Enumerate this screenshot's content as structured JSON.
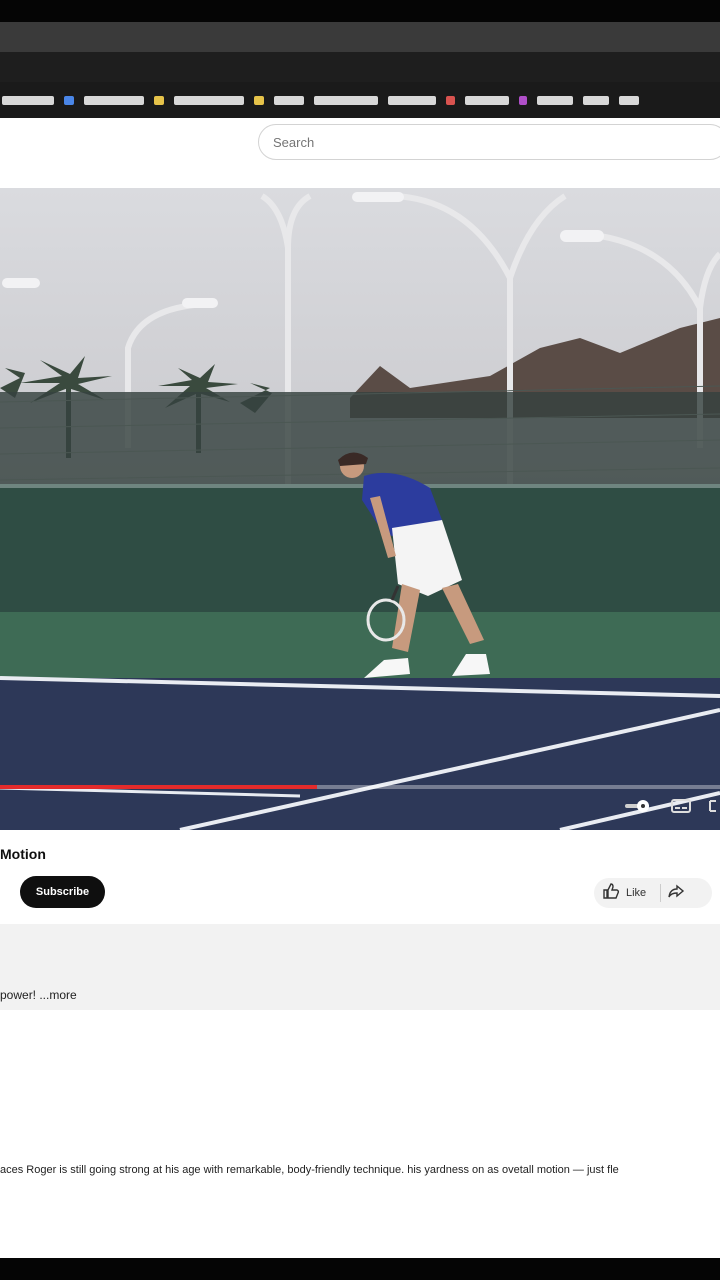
{
  "search": {
    "placeholder": "Search"
  },
  "video": {
    "title": "Motion",
    "progress_fraction": 0.44
  },
  "channel": {
    "subscribe_label": "Subscribe"
  },
  "actions": {
    "like_label": "Like"
  },
  "description": {
    "snippet": "power! ...more",
    "text": "aces Roger is still going strong at his age with remarkable, body-friendly technique. his yardness on as ovetall motion — just fle"
  },
  "colors": {
    "progress": "#e32b2b",
    "court_blue": "#2d3858",
    "court_green": "#3e6b55",
    "wall": "#2f4d44",
    "subscribe_bg": "#0f0f0f"
  },
  "icons": [
    "like-icon",
    "share-icon",
    "settings-icon",
    "captions-icon",
    "fullscreen-icon"
  ]
}
